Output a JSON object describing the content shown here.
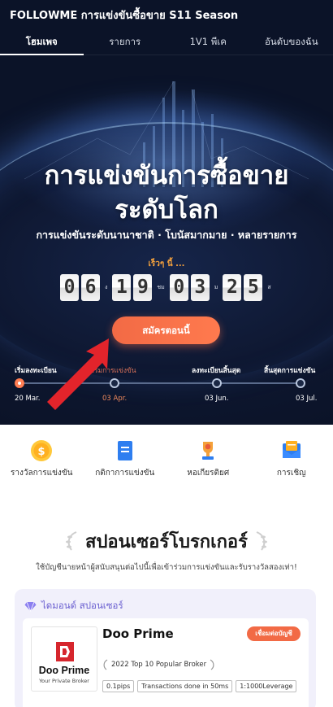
{
  "app": {
    "title": "FOLLOWME การแข่งขันซื้อขาย S11 Season"
  },
  "tabs": [
    {
      "label": "โฮมเพจ",
      "active": true
    },
    {
      "label": "รายการ",
      "active": false
    },
    {
      "label": "1V1 พีเค",
      "active": false
    },
    {
      "label": "อันดับของฉัน",
      "active": false
    }
  ],
  "hero": {
    "headline_line1": "การแข่งขันการซื้อขาย",
    "headline_line2": "ระดับโลก",
    "subline": "การแข่งขันระดับนานาชาติ · โบนัสมากมาย · หลายรายการ",
    "soon_label": "เร็วๆ นี้ ...",
    "countdown": {
      "days": "06",
      "days_unit": "ง",
      "hours": "19",
      "hours_unit": "ชม",
      "minutes": "03",
      "minutes_unit": "ม",
      "seconds": "25",
      "seconds_unit": "ส"
    },
    "cta_label": "สมัครตอนนี้"
  },
  "timeline": [
    {
      "label": "เริ่มลงทะเบียน",
      "date": "20 Mar.",
      "done": true
    },
    {
      "label": "เริ่มการแข่งขัน",
      "date": "03 Apr.",
      "done": false
    },
    {
      "label": "ลงทะเบียนสิ้นสุด",
      "date": "03 Jun.",
      "done": false
    },
    {
      "label": "สิ้นสุดการแข่งขัน",
      "date": "03 Jul.",
      "done": false
    }
  ],
  "features": [
    {
      "label": "รางวัลการแข่งขัน",
      "icon": "coin-icon"
    },
    {
      "label": "กติกาการแข่งขัน",
      "icon": "document-icon"
    },
    {
      "label": "หอเกียรติยศ",
      "icon": "trophy-icon"
    },
    {
      "label": "การเชิญ",
      "icon": "envelope-icon"
    }
  ],
  "sponsors": {
    "title": "สปอนเซอร์โบรกเกอร์",
    "subtitle": "ใช้บัญชีนายหน้าผู้สนับสนุนต่อไปนี้เพื่อเข้าร่วมการแข่งขันและรับรางวัลสองเท่า!",
    "tier_label": "ไดมอนด์ สปอนเซอร์",
    "broker": {
      "name": "Doo Prime",
      "logo_word": "Doo Prime",
      "logo_tagline": "Your Private Broker",
      "connect_label": "เชื่อมต่อบัญชี",
      "award": "2022 Top 10 Popular Broker",
      "tags": [
        "0.1pips",
        "Transactions done in 50ms",
        "1:1000Leverage"
      ]
    }
  },
  "colors": {
    "accent": "#f26a45",
    "hero_bg": "#0b1328",
    "sponsor_card": "#f1f0fb",
    "diamond": "#6a5fd0",
    "annotation_arrow": "#e3242b"
  }
}
